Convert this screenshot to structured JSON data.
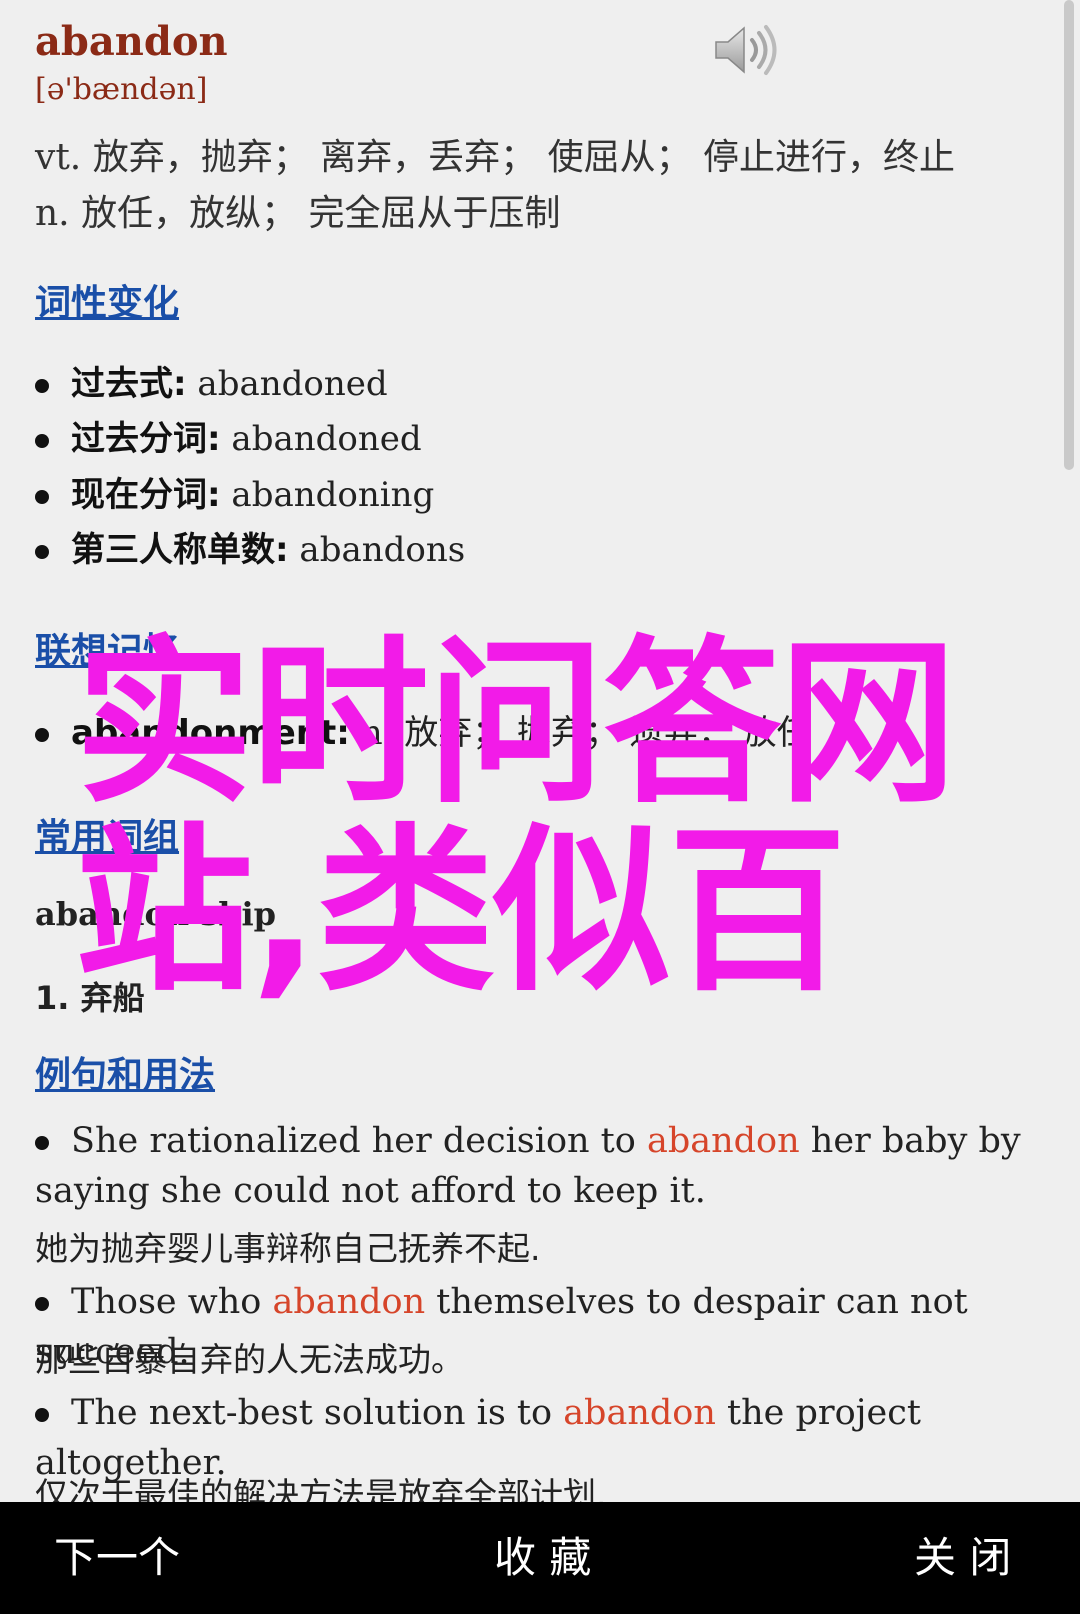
{
  "entry": {
    "word": "abandon",
    "phonetic": "[ə'bændən]",
    "definitions": [
      "vt. 放弃，抛弃；  离弃，丢弃；  使屈从；  停止进行，终止",
      "n. 放任，放纵；  完全屈从于压制"
    ]
  },
  "sections": {
    "inflections_title": "词性变化",
    "inflections": [
      {
        "label": "过去式:",
        "value": "abandoned"
      },
      {
        "label": "过去分词:",
        "value": "abandoned"
      },
      {
        "label": "现在分词:",
        "value": "abandoning"
      },
      {
        "label": "第三人称单数:",
        "value": "abandons"
      }
    ],
    "memory_title": "联想记忆",
    "memory_item": {
      "label": "abandonment:",
      "value": "n. 放弃；  抛弃；  遗弃；  放任"
    },
    "phrases_title": "常用词组",
    "phrase_head": "abandon ship",
    "phrase_def": "1. 弃船",
    "examples_title": "例句和用法",
    "examples": [
      {
        "before": "She rationalized her decision to ",
        "highlight": "abandon",
        "after": " her baby by saying she could not afford to keep it.",
        "translation": "她为抛弃婴儿事辩称自己抚养不起."
      },
      {
        "before": "Those who ",
        "highlight": "abandon",
        "after": " themselves to despair can not succeed.",
        "translation": "那些自暴自弃的人无法成功。"
      },
      {
        "before": "The next-best solution is to ",
        "highlight": "abandon",
        "after": " the project altogether.",
        "translation": "仅次于最佳的解决方法是放弃全部计划."
      }
    ]
  },
  "watermark": "实时问答网站,类似百",
  "bottom_bar": {
    "next": "下一个",
    "favorite": "收 藏",
    "close": "关 闭"
  },
  "colors": {
    "headword": "#8b2a16",
    "link": "#1a4fa8",
    "highlight": "#d6452a",
    "watermark": "#f21be8",
    "bar": "#000000"
  }
}
